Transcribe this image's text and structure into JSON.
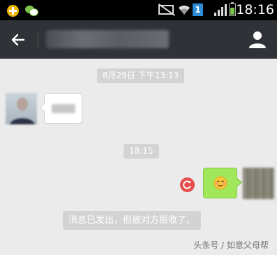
{
  "status_bar": {
    "time": "18:16",
    "sim_label": "1",
    "notification_icons": [
      "plus-notification-icon",
      "wechat-notification-icon"
    ],
    "status_icons": [
      "silent-icon",
      "wifi-icon",
      "sim-icon",
      "signal-icon",
      "battery-icon"
    ],
    "colors": {
      "background": "#000000",
      "sim": "#2b8cd8",
      "battery": "#7cc44a"
    }
  },
  "title_bar": {
    "back_icon": "arrow-left-icon",
    "contact_name": "",
    "profile_icon": "person-icon",
    "colors": {
      "background": "#2f3337"
    }
  },
  "chat": {
    "messages": [
      {
        "type": "timestamp",
        "text": "8月29日 下午13:13"
      },
      {
        "type": "incoming",
        "text": "",
        "avatar": "blurred-photo"
      },
      {
        "type": "timestamp",
        "text": "18:15"
      },
      {
        "type": "outgoing",
        "emoji": "smiling-face-emoji",
        "status_icon": "resend-icon",
        "avatar": "blurred-photo"
      },
      {
        "type": "system",
        "text": "消息已发出，但被对方拒收了。"
      }
    ],
    "colors": {
      "background": "#ebebeb",
      "outgoing_bubble": "#a0e759",
      "incoming_bubble": "#ffffff",
      "pill": "#d3d3d3",
      "resend": "#e74c4c"
    }
  },
  "watermark": "头条号 / 如意父母帮"
}
